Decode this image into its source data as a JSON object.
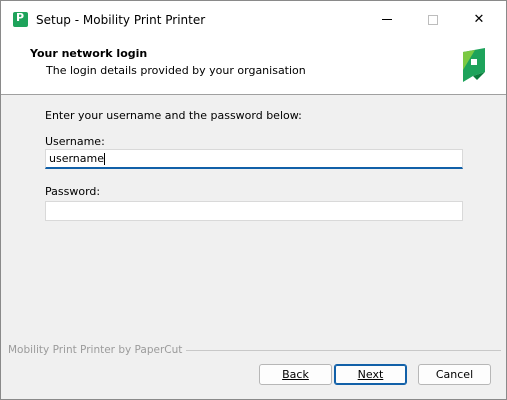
{
  "window": {
    "title": "Setup - Mobility Print Printer",
    "minimize_icon": "minimize-icon",
    "maximize_icon": "maximize-icon",
    "close_icon": "close-icon",
    "app_icon_color": "#1ea35b"
  },
  "header": {
    "title": "Your network login",
    "subtitle": "The login details provided by your organisation",
    "logo_colors": [
      "#1ea35b",
      "#7bc943",
      "#0b7a3b"
    ]
  },
  "form": {
    "prompt": "Enter your username and the password below:",
    "username_label": "Username:",
    "username_value": "username",
    "password_label": "Password:",
    "password_value": ""
  },
  "footer": {
    "brand": "Mobility Print Printer by PaperCut",
    "back_label": "Back",
    "next_label": "Next",
    "cancel_label": "Cancel"
  },
  "accent_color": "#1160a8"
}
